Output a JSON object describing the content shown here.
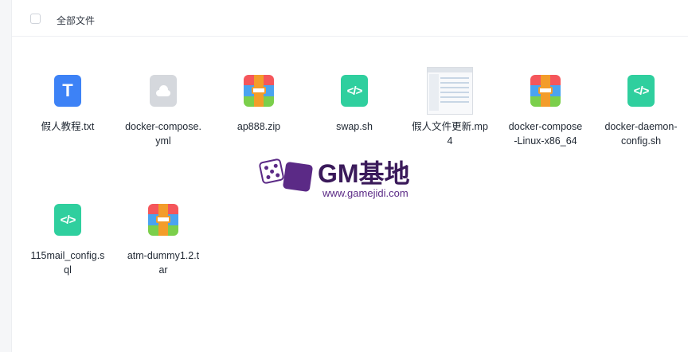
{
  "header": {
    "title": "全部文件"
  },
  "files": [
    {
      "name": "假人教程.txt",
      "icon": "text-doc-icon",
      "glyph": "T"
    },
    {
      "name": "docker-compose.yml",
      "icon": "cloud-doc-icon"
    },
    {
      "name": "ap888.zip",
      "icon": "archive-icon"
    },
    {
      "name": "swap.sh",
      "icon": "code-file-icon",
      "glyph": "</>"
    },
    {
      "name": "假人文件更新.mp4",
      "icon": "video-thumbnail-icon"
    },
    {
      "name": "docker-compose-Linux-x86_64",
      "icon": "archive-icon"
    },
    {
      "name": "docker-daemon-config.sh",
      "icon": "code-file-icon",
      "glyph": "</>"
    },
    {
      "name": "115mail_config.sql",
      "icon": "code-file-icon",
      "glyph": "</>"
    },
    {
      "name": "atm-dummy1.2.tar",
      "icon": "archive-icon"
    }
  ],
  "watermark": {
    "title": "GM基地",
    "url": "www.gamejidi.com"
  },
  "colors": {
    "text_doc": "#3d82f6",
    "code_file": "#2fcf9e",
    "cloud_doc": "#d5d8dd",
    "watermark": "#5b2a86"
  }
}
